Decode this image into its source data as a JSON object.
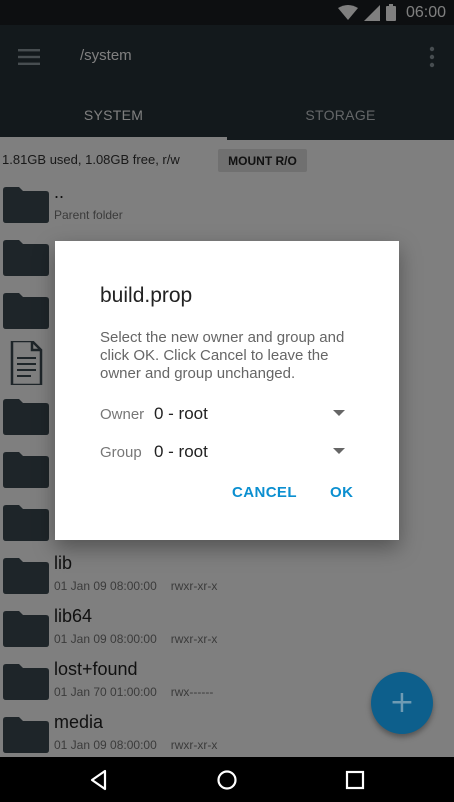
{
  "status_bar": {
    "time": "06:00"
  },
  "app_bar": {
    "path": "/system"
  },
  "tabs": [
    {
      "label": "SYSTEM"
    },
    {
      "label": "STORAGE"
    }
  ],
  "info": {
    "usage": "1.81GB used, 1.08GB free, r/w",
    "mount_button": "MOUNT R/O"
  },
  "files": [
    {
      "name": "..",
      "meta": "Parent folder",
      "perm": "",
      "icon": "folder-icon"
    },
    {
      "name": "",
      "meta": "",
      "perm": "",
      "icon": "folder-icon"
    },
    {
      "name": "",
      "meta": "",
      "perm": "",
      "icon": "folder-icon"
    },
    {
      "name": "",
      "meta": "",
      "perm": "",
      "icon": "document-icon"
    },
    {
      "name": "",
      "meta": "",
      "perm": "",
      "icon": "folder-icon"
    },
    {
      "name": "",
      "meta": "",
      "perm": "",
      "icon": "folder-icon"
    },
    {
      "name": "",
      "meta": "",
      "perm": "",
      "icon": "folder-icon"
    },
    {
      "name": "lib",
      "meta": "01 Jan 09 08:00:00",
      "perm": "rwxr-xr-x",
      "icon": "folder-icon"
    },
    {
      "name": "lib64",
      "meta": "01 Jan 09 08:00:00",
      "perm": "rwxr-xr-x",
      "icon": "folder-icon"
    },
    {
      "name": "lost+found",
      "meta": "01 Jan 70 01:00:00",
      "perm": "rwx------",
      "icon": "folder-icon"
    },
    {
      "name": "media",
      "meta": "01 Jan 09 08:00:00",
      "perm": "rwxr-xr-x",
      "icon": "folder-icon"
    }
  ],
  "dialog": {
    "title": "build.prop",
    "message": "Select the new owner and group and click OK. Click Cancel to leave the owner and group unchanged.",
    "owner_label": "Owner",
    "owner_value": "0 - root",
    "group_label": "Group",
    "group_value": "0 - root",
    "cancel_label": "CANCEL",
    "ok_label": "OK"
  },
  "fab": {
    "label": "+"
  },
  "colors": {
    "accent": "#0b8fd0",
    "toolbar": "#263238",
    "fab": "#0d5f8c"
  }
}
